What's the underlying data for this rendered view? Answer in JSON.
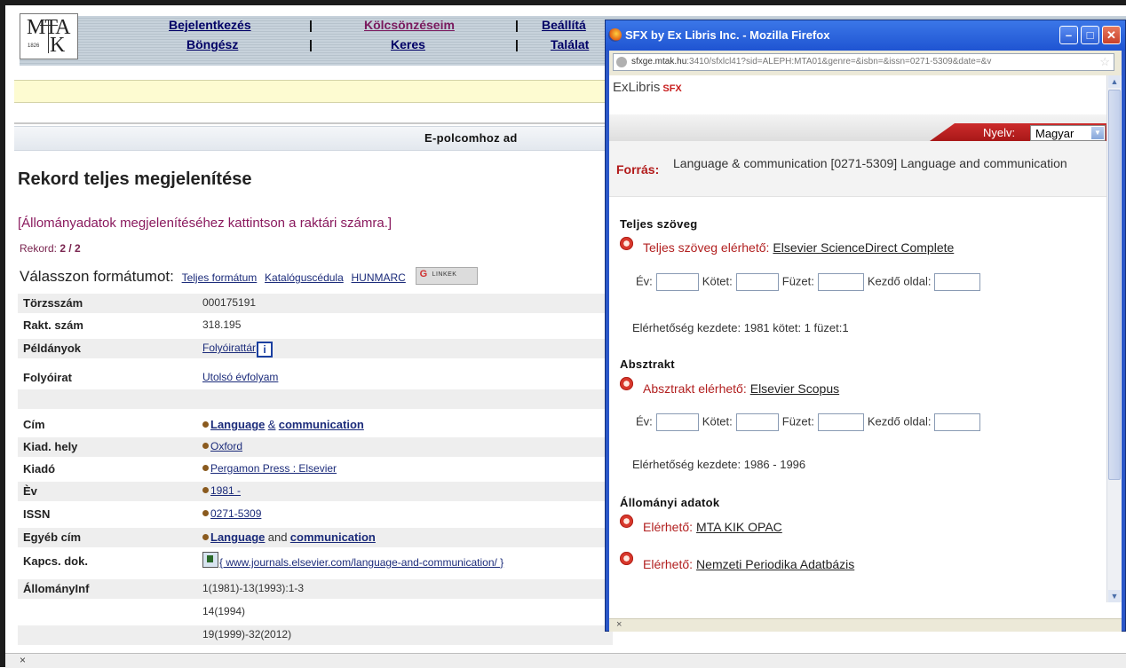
{
  "background_page": {
    "logo": {
      "main": "MTA",
      "letter_k": "K",
      "year": "1826"
    },
    "nav": {
      "row1": [
        "Bejelentkezés",
        "Kölcsönzéseim",
        "Beállítá"
      ],
      "row2": [
        "Böngész",
        "Keres",
        "Találat"
      ],
      "separator": "|",
      "k_fragment": "K"
    },
    "epolc_label": "E-polcomhoz ad",
    "page_title": "Rekord teljes megjelenítése",
    "hint": "[Állományadatok megjelenítéséhez kattintson a raktári számra.]",
    "rekord_label": "Rekord:",
    "rekord_value": "2 / 2",
    "format_label": "Válasszon formátumot:",
    "format_links": [
      "Teljes formátum",
      "Katalóguscédula",
      "HUNMARC"
    ],
    "linkek_label": "LINKEK",
    "record": {
      "torzsszam": {
        "label": "Törzsszám",
        "value": "000175191"
      },
      "rakt_szam": {
        "label": "Rakt. szám",
        "value": "318.195"
      },
      "peldanyok": {
        "label": "Példányok",
        "value": "Folyóirattár"
      },
      "folyoirat": {
        "label": "Folyóirat",
        "value": "Utolsó évfolyam"
      },
      "cim": {
        "label": "Cím",
        "value_bold1": "Language",
        "value_mid": "&",
        "value_bold2": "communication"
      },
      "kiad_hely": {
        "label": "Kiad. hely",
        "value": "Oxford"
      },
      "kiado": {
        "label": "Kiadó",
        "value": "Pergamon Press : Elsevier"
      },
      "ev": {
        "label": "Èv",
        "value": "1981 -"
      },
      "issn": {
        "label": "ISSN",
        "value": "0271-5309"
      },
      "egyeb_cim": {
        "label": "Egyéb cím",
        "value_bold1": "Language",
        "value_mid": "and",
        "value_bold2": "communication"
      },
      "kapcs_dok": {
        "label": "Kapcs. dok.",
        "value": "{ www.journals.elsevier.com/language-and-communication/ }"
      },
      "allomanyinf": {
        "label": "ÁllományInf",
        "values": [
          "1(1981)-13(1993):1-3",
          "14(1994)",
          "19(1999)-32(2012)"
        ]
      }
    },
    "status_x": "×"
  },
  "popup": {
    "title": "SFX by Ex Libris Inc. - Mozilla Firefox",
    "address_host": "sfxge.mtak.hu",
    "address_rest": ":3410/sfxlcl41?sid=ALEPH:MTA01&genre=&isbn=&issn=0271-5309&date=&v",
    "brand": "ExLibris",
    "brand_suffix": "SFX",
    "nyelv_label": "Nyelv:",
    "nyelv_value": "Magyar",
    "forras_label": "Forrás:",
    "forras_value": "Language & communication [0271-5309] Language and communication",
    "sections": {
      "teljes": {
        "title": "Teljes szöveg",
        "service_label": "Teljes szöveg elérhető:",
        "service_link": "Elsevier ScienceDirect Complete",
        "availability": "Elérhetőség kezdete: 1981 kötet: 1 füzet:1"
      },
      "absztrakt": {
        "title": "Absztrakt",
        "service_label": "Absztrakt elérhető:",
        "service_link": "Elsevier Scopus",
        "availability": "Elérhetőség kezdete: 1986 - 1996"
      },
      "allomanyi": {
        "title": "Állományi adatok",
        "item1_label": "Elérhető:",
        "item1_link": "MTA KIK OPAC",
        "item2_label": "Elérhető:",
        "item2_link": "Nemzeti Periodika Adatbázis"
      }
    },
    "form": {
      "ev": "Év:",
      "kotet": "Kötet:",
      "fuzet": "Füzet:",
      "kezdo": "Kezdő oldal:"
    },
    "status_x": "×",
    "colors": {
      "title_bar": "#2b5fd6",
      "accent_red": "#b21a1a"
    }
  }
}
